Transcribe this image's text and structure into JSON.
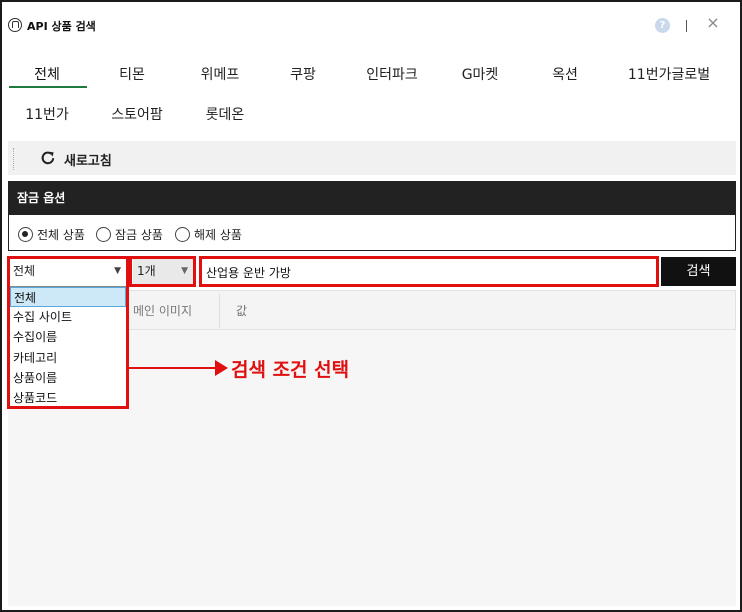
{
  "app": {
    "title": "API 상품 검색",
    "help_glyph": "?",
    "close_glyph": "×"
  },
  "tabs": [
    {
      "label": "전체"
    },
    {
      "label": "티몬"
    },
    {
      "label": "위메프"
    },
    {
      "label": "쿠팡"
    },
    {
      "label": "인터파크"
    },
    {
      "label": "G마켓"
    },
    {
      "label": "옥션"
    },
    {
      "label": "11번가글로벌"
    },
    {
      "label": "11번가"
    },
    {
      "label": "스토어팜"
    },
    {
      "label": "롯데온"
    }
  ],
  "toolbar": {
    "refresh_label": "새로고침"
  },
  "lock_options": {
    "header": "잠금 옵션",
    "options": [
      {
        "label": "전체 상품",
        "checked": true
      },
      {
        "label": "잠금 상품",
        "checked": false
      },
      {
        "label": "해제 상품",
        "checked": false
      }
    ]
  },
  "search": {
    "field_select": "전체",
    "count_select": "1개",
    "query": "산업용 운반 가방",
    "button_label": "검색",
    "field_options": [
      "전체",
      "수집 사이트",
      "수집이름",
      "카테고리",
      "상품이름",
      "상품코드"
    ]
  },
  "table": {
    "columns": [
      "메인 이미지",
      "값"
    ]
  },
  "annotation": {
    "text": "검색 조건 선택",
    "color": "#e01010"
  },
  "colors": {
    "accent": "#1f7a3d",
    "header_bg": "#222222",
    "highlight": "#e01010"
  }
}
